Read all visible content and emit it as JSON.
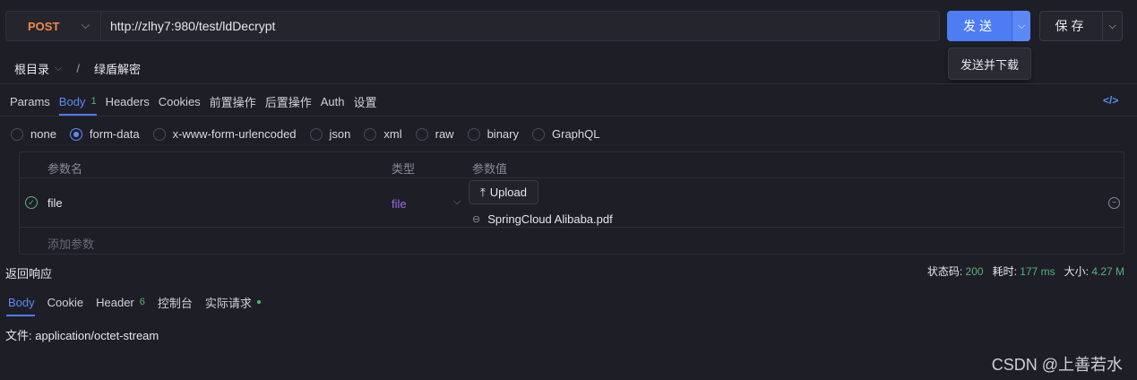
{
  "request": {
    "method": "POST",
    "url": "http://zlhy7:980/test/ldDecrypt",
    "send_label": "发送",
    "save_label": "保存",
    "send_menu_item": "发送并下载"
  },
  "breadcrumb": {
    "root": "根目录",
    "separator": "/",
    "current": "绿盾解密"
  },
  "request_tabs": [
    {
      "label": "Params"
    },
    {
      "label": "Body",
      "badge": "1"
    },
    {
      "label": "Headers"
    },
    {
      "label": "Cookies"
    },
    {
      "label": "前置操作"
    },
    {
      "label": "后置操作"
    },
    {
      "label": "Auth"
    },
    {
      "label": "设置"
    }
  ],
  "code_icon": "</>",
  "body_types": [
    "none",
    "form-data",
    "x-www-form-urlencoded",
    "json",
    "xml",
    "raw",
    "binary",
    "GraphQL"
  ],
  "body_type_selected": "form-data",
  "params_table": {
    "headers": {
      "name": "参数名",
      "type": "类型",
      "value": "参数值"
    },
    "rows": [
      {
        "name": "file",
        "type": "file",
        "upload_label": "Upload",
        "file_name": "SpringCloud Alibaba.pdf"
      }
    ],
    "add_placeholder": "添加参数"
  },
  "response": {
    "title": "返回响应",
    "status_label": "状态码:",
    "status_value": "200",
    "time_label": "耗时:",
    "time_value": "177 ms",
    "size_label": "大小:",
    "size_value": "4.27 M",
    "tabs": [
      {
        "label": "Body"
      },
      {
        "label": "Cookie"
      },
      {
        "label": "Header",
        "badge": "6"
      },
      {
        "label": "控制台"
      },
      {
        "label": "实际请求"
      }
    ],
    "file_text": "文件: application/octet-stream"
  },
  "watermark": "CSDN @上善若水",
  "colors": {
    "accent": "#4d7cf3",
    "method": "#ef8a47",
    "success": "#4fb67a",
    "type": "#9b6ee8"
  }
}
